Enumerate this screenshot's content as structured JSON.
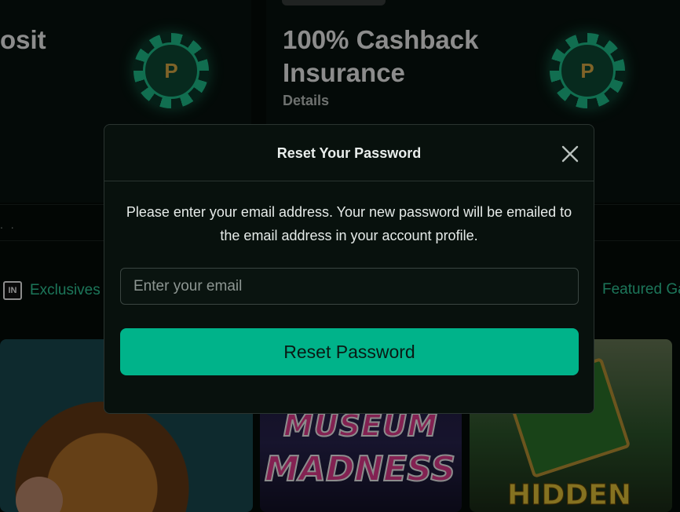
{
  "promos": {
    "left_title_fragment": "osit",
    "right_title": "100% Cashback Insurance",
    "right_details": "Details"
  },
  "dots_text": ". .",
  "nav": {
    "exclusives_label": "Exclusives",
    "exclusives_icon_text": "IN",
    "featured_label": "Featured Ga"
  },
  "games": {
    "tile2_line1": "MUSEUM",
    "tile2_line2": "MADNESS",
    "tile3_text": "HIDDEN"
  },
  "modal": {
    "title": "Reset Your Password",
    "message": "Please enter your email address. Your new password will be emailed to the email address in your account profile.",
    "email_placeholder": "Enter your email",
    "email_value": "",
    "submit_label": "Reset Password"
  },
  "colors": {
    "accent": "#00b38a",
    "link": "#34d6a3",
    "modal_bg": "#08110d",
    "page_bg": "#050c09"
  },
  "icons": {
    "close": "close-icon",
    "chip": "casino-chip-icon",
    "exclusives": "in-badge-icon"
  }
}
